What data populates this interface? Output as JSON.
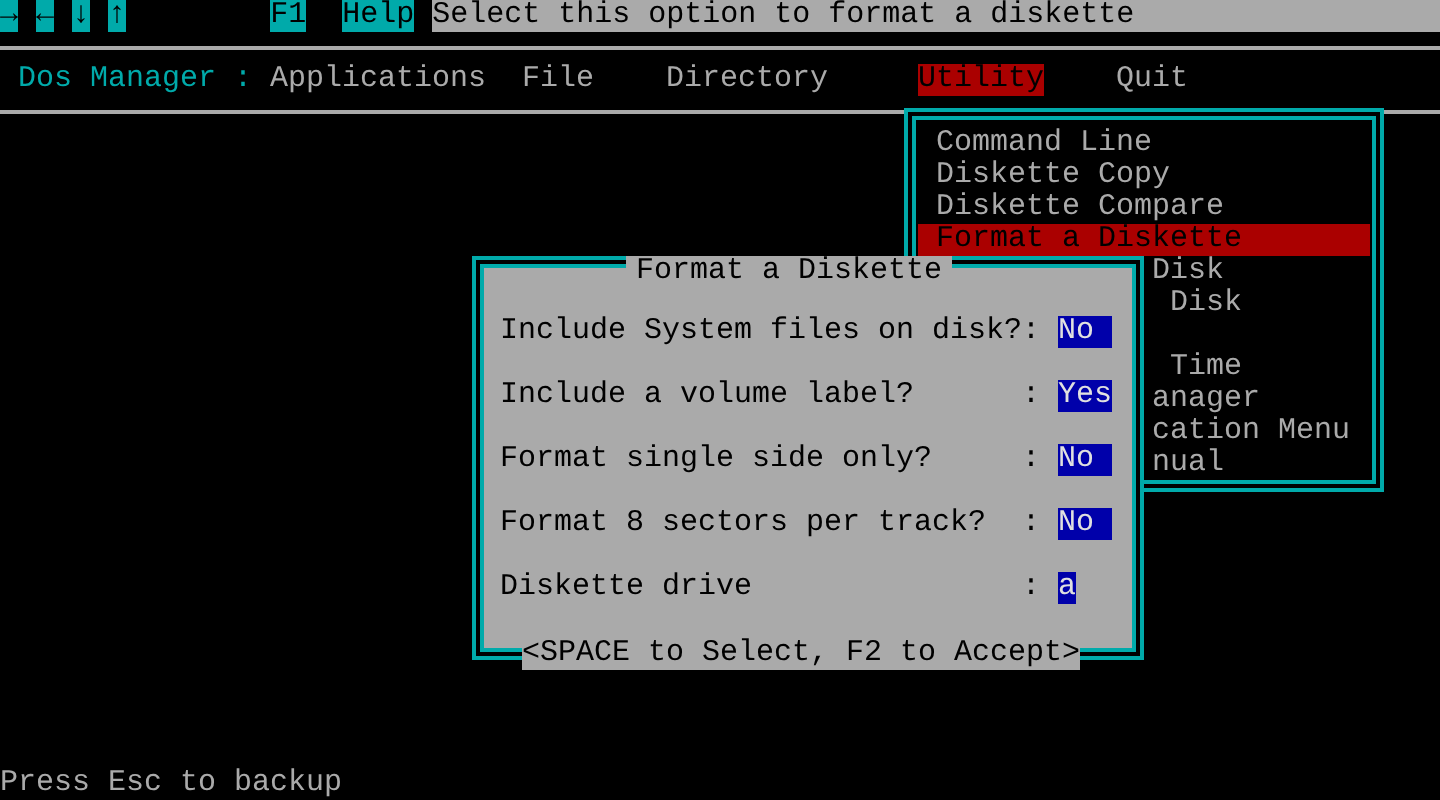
{
  "key_bar": {
    "keys": [
      "→",
      "←",
      "↓",
      "↑"
    ],
    "f1": "F1",
    "help": "Help",
    "message": "Select this option to format a diskette"
  },
  "menu_bar": {
    "title": "Dos Manager :",
    "items": [
      {
        "label": "Applications",
        "selected": false
      },
      {
        "label": "File",
        "selected": false
      },
      {
        "label": "Directory",
        "selected": false
      },
      {
        "label": "Utility",
        "selected": true
      },
      {
        "label": "Quit",
        "selected": false
      }
    ]
  },
  "utility_menu": {
    "items": [
      {
        "label": "Command Line",
        "selected": false
      },
      {
        "label": "Diskette Copy",
        "selected": false
      },
      {
        "label": "Diskette Compare",
        "selected": false
      },
      {
        "label": "Format a Diskette",
        "selected": true
      }
    ],
    "partly_hidden_items": [
      "Disk",
      " Disk",
      " Time",
      "anager",
      "cation Menu",
      "nual"
    ]
  },
  "dialog": {
    "title": "Format a Diskette",
    "fields": [
      {
        "label": "Include System files on disk?",
        "separator": ":",
        "value": "No",
        "kind": "toggle"
      },
      {
        "label": "Include a volume label?",
        "separator": ":",
        "value": "Yes",
        "kind": "toggle"
      },
      {
        "label": "Format single side only?",
        "separator": ":",
        "value": "No",
        "kind": "toggle"
      },
      {
        "label": "Format 8 sectors per track?",
        "separator": ":",
        "value": "No",
        "kind": "toggle"
      },
      {
        "label": "Diskette drive",
        "separator": ":",
        "value": "a",
        "kind": "drive"
      }
    ],
    "hint": "<SPACE to Select, F2 to Accept>"
  },
  "status_line": "Press Esc to backup"
}
